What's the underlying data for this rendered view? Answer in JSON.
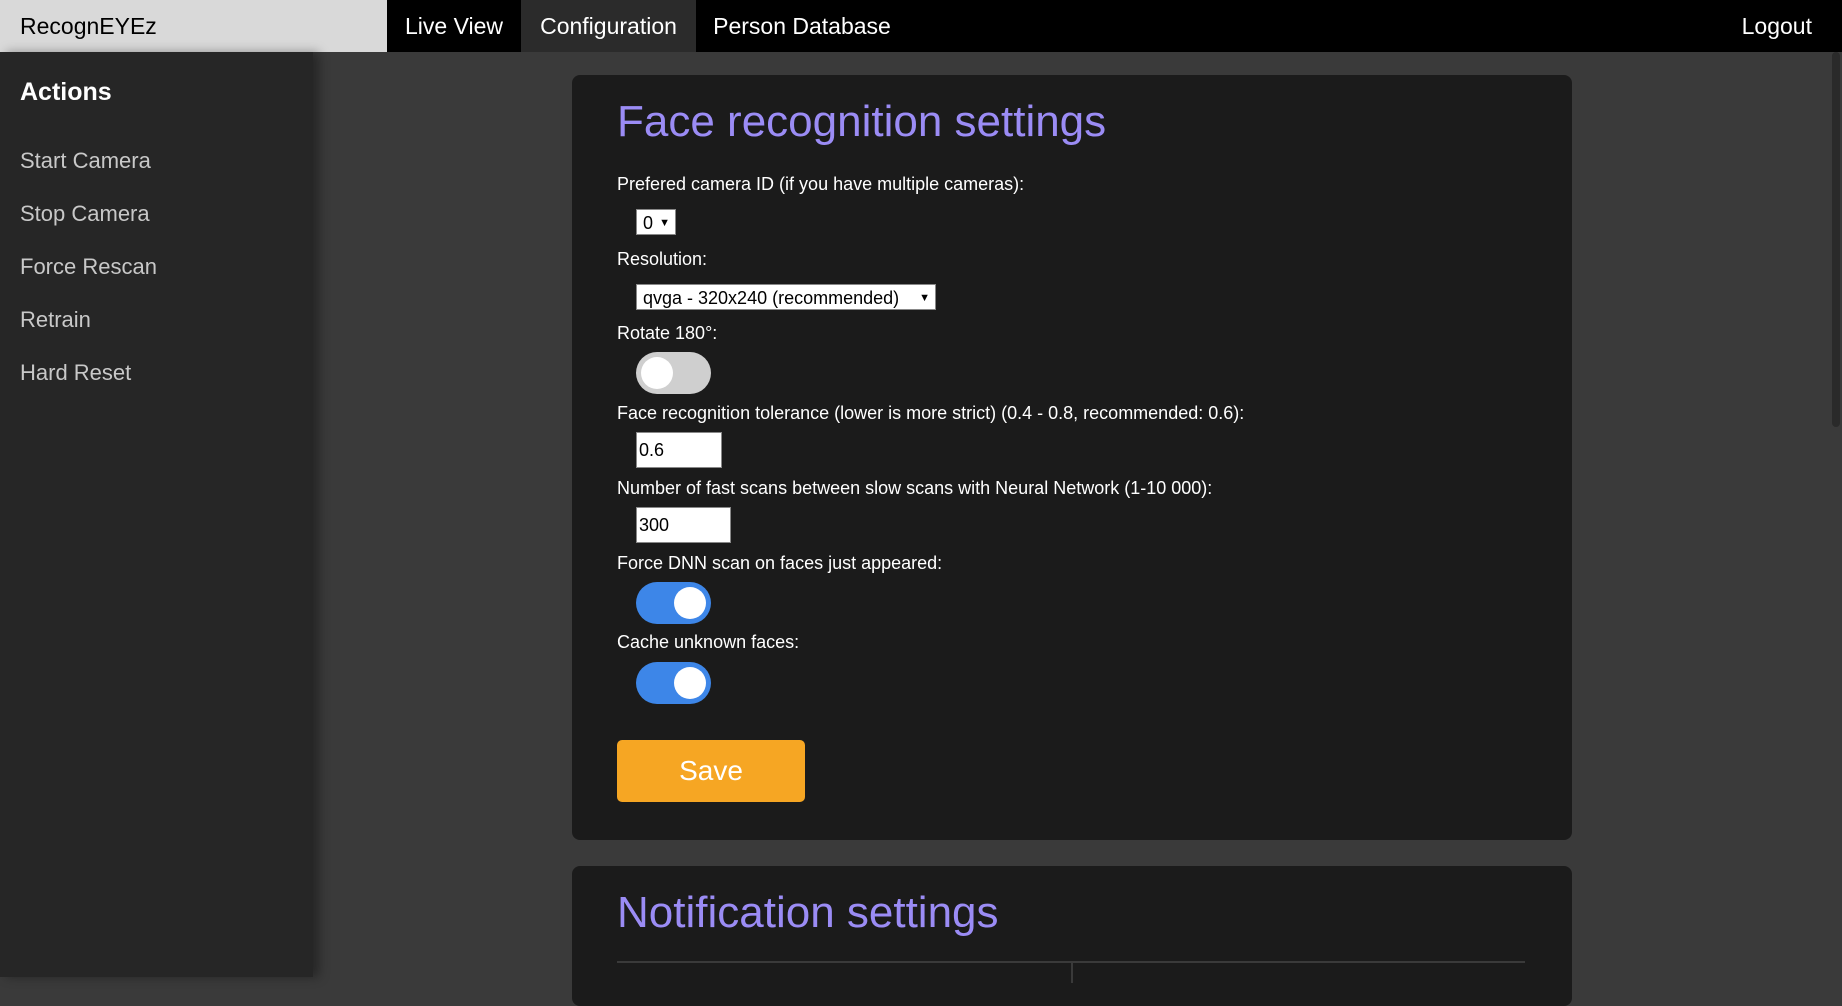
{
  "app": {
    "title": "RecognEYEz"
  },
  "nav": {
    "tabs": [
      {
        "label": "Live View",
        "active": false
      },
      {
        "label": "Configuration",
        "active": true
      },
      {
        "label": "Person Database",
        "active": false
      }
    ],
    "logout_label": "Logout"
  },
  "sidebar": {
    "title": "Actions",
    "items": [
      {
        "label": "Start Camera"
      },
      {
        "label": "Stop Camera"
      },
      {
        "label": "Force Rescan"
      },
      {
        "label": "Retrain"
      },
      {
        "label": "Hard Reset"
      }
    ]
  },
  "face_settings": {
    "title": "Face recognition settings",
    "camera_id": {
      "label": "Prefered camera ID (if you have multiple cameras):",
      "value": "0"
    },
    "resolution": {
      "label": "Resolution:",
      "value": "qvga - 320x240 (recommended)"
    },
    "rotate": {
      "label": "Rotate 180°:",
      "on": false
    },
    "tolerance": {
      "label": "Face recognition tolerance (lower is more strict) (0.4 - 0.8, recommended: 0.6):",
      "value": "0.6"
    },
    "fast_scans": {
      "label": "Number of fast scans between slow scans with Neural Network (1-10 000):",
      "value": "300"
    },
    "force_dnn": {
      "label": "Force DNN scan on faces just appeared:",
      "on": true
    },
    "cache_unknown": {
      "label": "Cache unknown faces:",
      "on": true
    },
    "save_label": "Save"
  },
  "notification_settings": {
    "title": "Notification settings"
  },
  "colors": {
    "accent_title": "#9b8cf5",
    "save_button": "#f6a623",
    "toggle_on": "#3d86e8",
    "toggle_off": "#cfcfcf"
  },
  "icons": {
    "select_caret": "caret-down-icon"
  }
}
